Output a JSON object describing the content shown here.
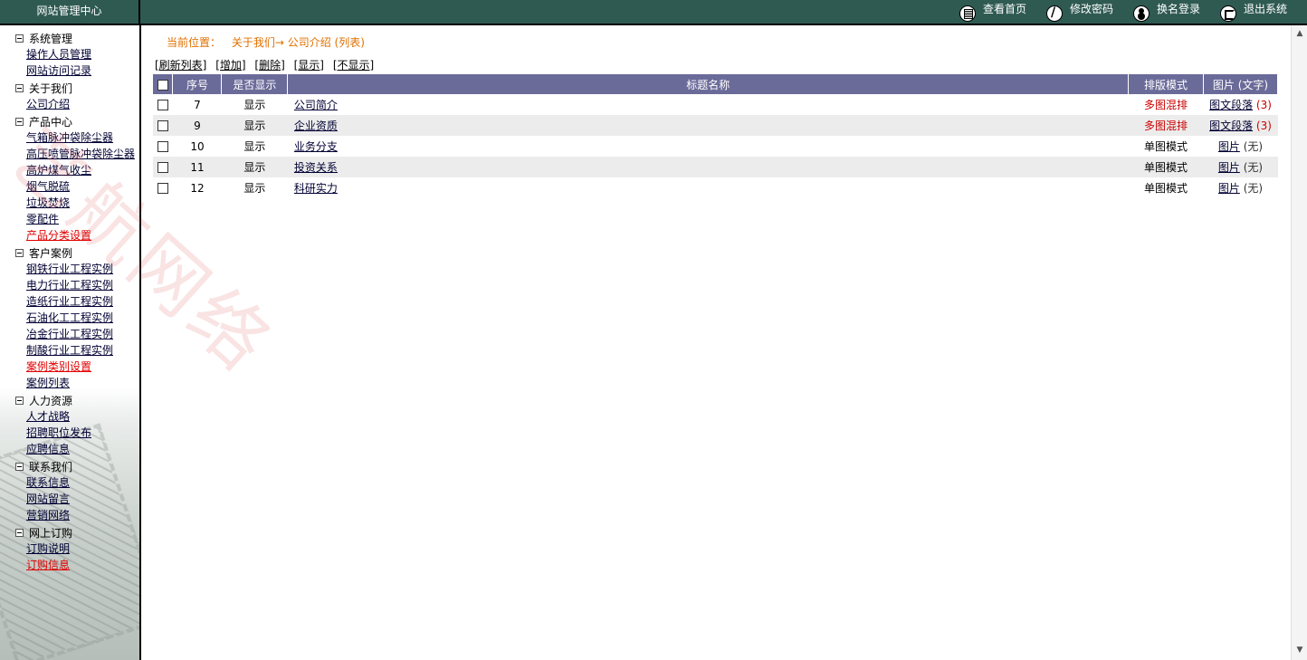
{
  "header": {
    "brand": "网站管理中心",
    "links": [
      {
        "icon": "home-page-icon",
        "label": "查看首页"
      },
      {
        "icon": "key-icon",
        "label": "修改密码"
      },
      {
        "icon": "user-icon",
        "label": "换名登录"
      },
      {
        "icon": "exit-icon",
        "label": "退出系统"
      }
    ]
  },
  "sidebar": {
    "groups": [
      {
        "title": "系统管理",
        "items": [
          {
            "label": "操作人员管理",
            "red": false
          },
          {
            "label": "网站访问记录",
            "red": false
          }
        ]
      },
      {
        "title": "关于我们",
        "items": [
          {
            "label": "公司介绍",
            "red": false
          }
        ]
      },
      {
        "title": "产品中心",
        "items": [
          {
            "label": "气箱脉冲袋除尘器",
            "red": false
          },
          {
            "label": "高压喷管脉冲袋除尘器",
            "red": false
          },
          {
            "label": "高炉煤气收尘",
            "red": false
          },
          {
            "label": "烟气脱硫",
            "red": false
          },
          {
            "label": "垃圾焚烧",
            "red": false
          },
          {
            "label": "零配件",
            "red": false
          },
          {
            "label": "产品分类设置",
            "red": true
          }
        ]
      },
      {
        "title": "客户案例",
        "items": [
          {
            "label": "钢铁行业工程实例",
            "red": false
          },
          {
            "label": "电力行业工程实例",
            "red": false
          },
          {
            "label": "造纸行业工程实例",
            "red": false
          },
          {
            "label": "石油化工工程实例",
            "red": false
          },
          {
            "label": "冶金行业工程实例",
            "red": false
          },
          {
            "label": "制酸行业工程实例",
            "red": false
          },
          {
            "label": "案例类别设置",
            "red": true
          },
          {
            "label": "案例列表",
            "red": false
          }
        ]
      },
      {
        "title": "人力资源",
        "items": [
          {
            "label": "人才战略",
            "red": false
          },
          {
            "label": "招聘职位发布",
            "red": false
          },
          {
            "label": "应聘信息",
            "red": false
          }
        ]
      },
      {
        "title": "联系我们",
        "items": [
          {
            "label": "联系信息",
            "red": false
          },
          {
            "label": "网站留言",
            "red": false
          },
          {
            "label": "营销网络",
            "red": false
          }
        ]
      },
      {
        "title": "网上订购",
        "items": [
          {
            "label": "订购说明",
            "red": false
          },
          {
            "label": "订购信息",
            "red": true
          }
        ]
      }
    ]
  },
  "breadcrumb": {
    "prefix": "当前位置：",
    "path": "关于我们→ 公司介绍 (列表)"
  },
  "actions": [
    "[刷新列表]",
    "[增加]",
    "[删除]",
    "[显示]",
    "[不显示]"
  ],
  "table": {
    "headers": [
      "",
      "序号",
      "是否显示",
      "标题名称",
      "排版模式",
      "图片 (文字)"
    ],
    "rows": [
      {
        "id": "7",
        "show": "显示",
        "title": "公司简介",
        "layout": "多图混排",
        "layout_red": true,
        "pic": "图文段落",
        "count": "(3)"
      },
      {
        "id": "9",
        "show": "显示",
        "title": "企业资质",
        "layout": "多图混排",
        "layout_red": true,
        "pic": "图文段落",
        "count": "(3)"
      },
      {
        "id": "10",
        "show": "显示",
        "title": "业务分支",
        "layout": "单图模式",
        "layout_red": false,
        "pic": "图片",
        "count": "(无)"
      },
      {
        "id": "11",
        "show": "显示",
        "title": "投资关系",
        "layout": "单图模式",
        "layout_red": false,
        "pic": "图片",
        "count": "(无)"
      },
      {
        "id": "12",
        "show": "显示",
        "title": "科研实力",
        "layout": "单图模式",
        "layout_red": false,
        "pic": "图片",
        "count": "(无)"
      }
    ]
  },
  "watermark": "艺航网络",
  "colors": {
    "header_bg": "#2f5a52",
    "table_header": "#6b6b9a",
    "crumb": "#e07000",
    "alert": "#cc0000"
  }
}
